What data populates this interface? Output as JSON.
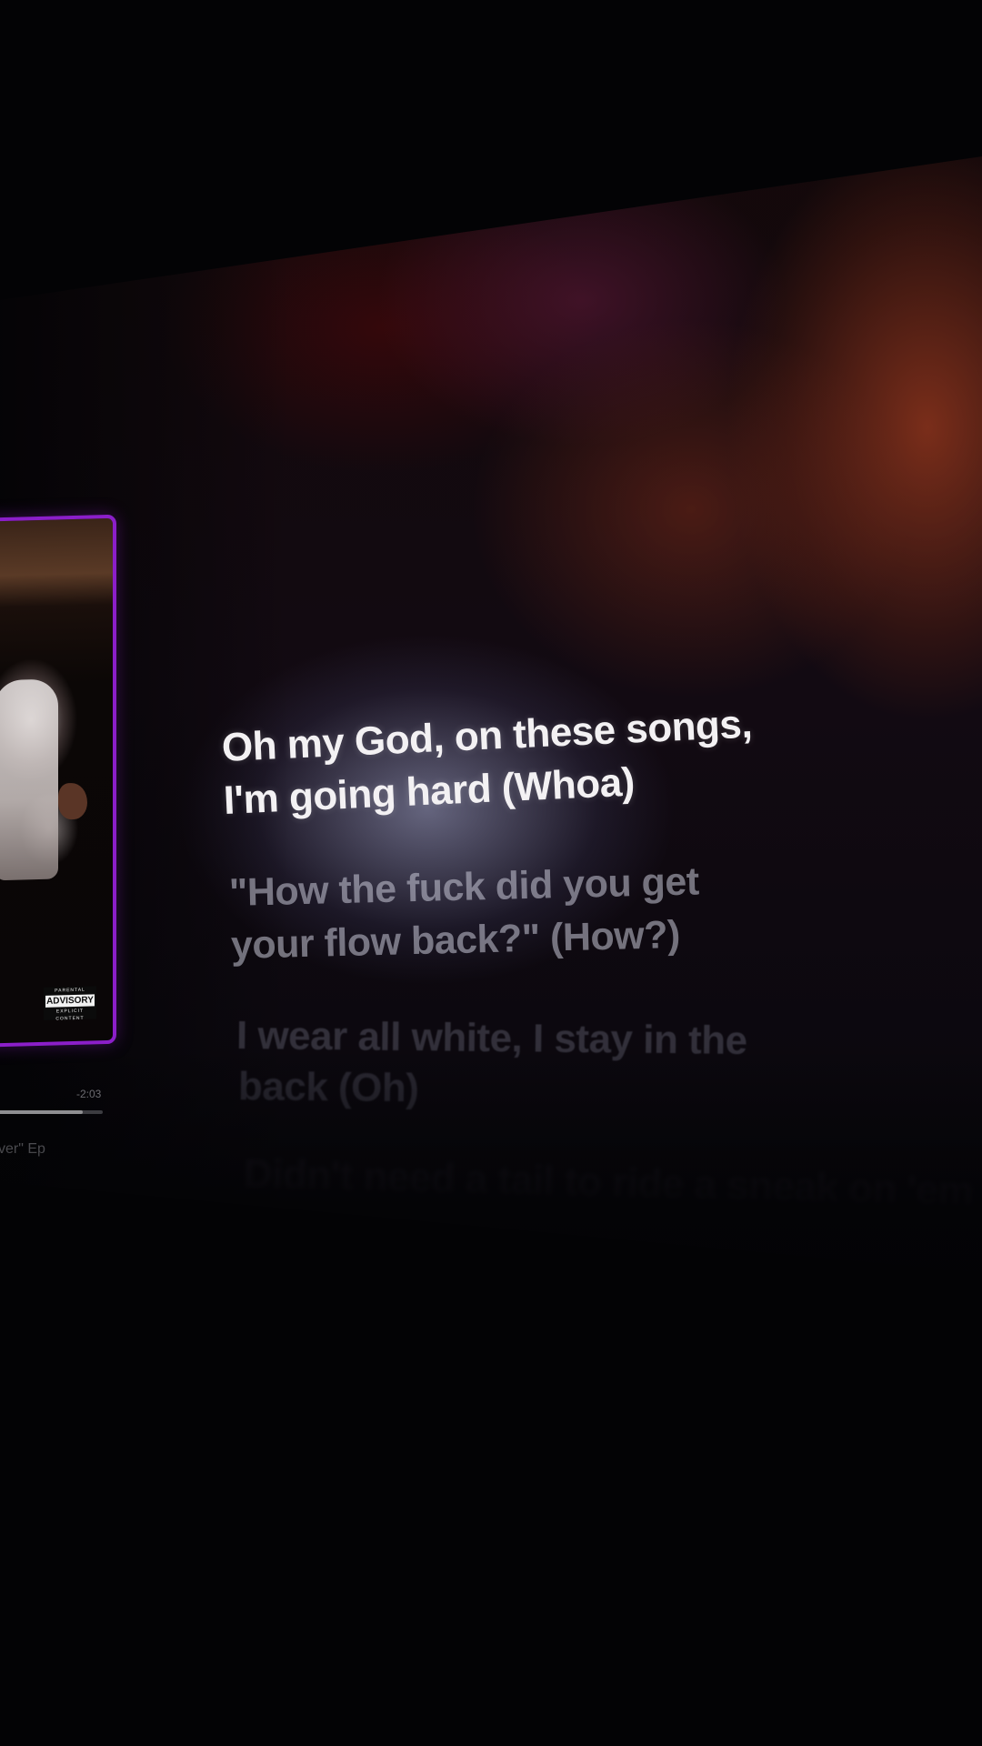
{
  "player": {
    "time_remaining": "-2:03",
    "progress_fraction": 0.82,
    "album_partial": "ver\" Ep",
    "advisory": {
      "top": "PARENTAL",
      "middle": "ADVISORY",
      "bottom": "EXPLICIT CONTENT"
    }
  },
  "lyrics": {
    "current": [
      "Oh my God, on these songs,",
      "I'm going hard (Whoa)"
    ],
    "next": [
      "\"How the fuck did you get",
      "your flow back?\" (How?)"
    ],
    "after": [
      "I wear all white, I stay in the",
      "back (Oh)"
    ],
    "upcoming_blurred": "Didn't need a tail to ride a sneak on 'em"
  },
  "colors": {
    "artwork_border": "#8b1fc9",
    "current_lyric": "#f3f1f3",
    "background": "#030305"
  }
}
